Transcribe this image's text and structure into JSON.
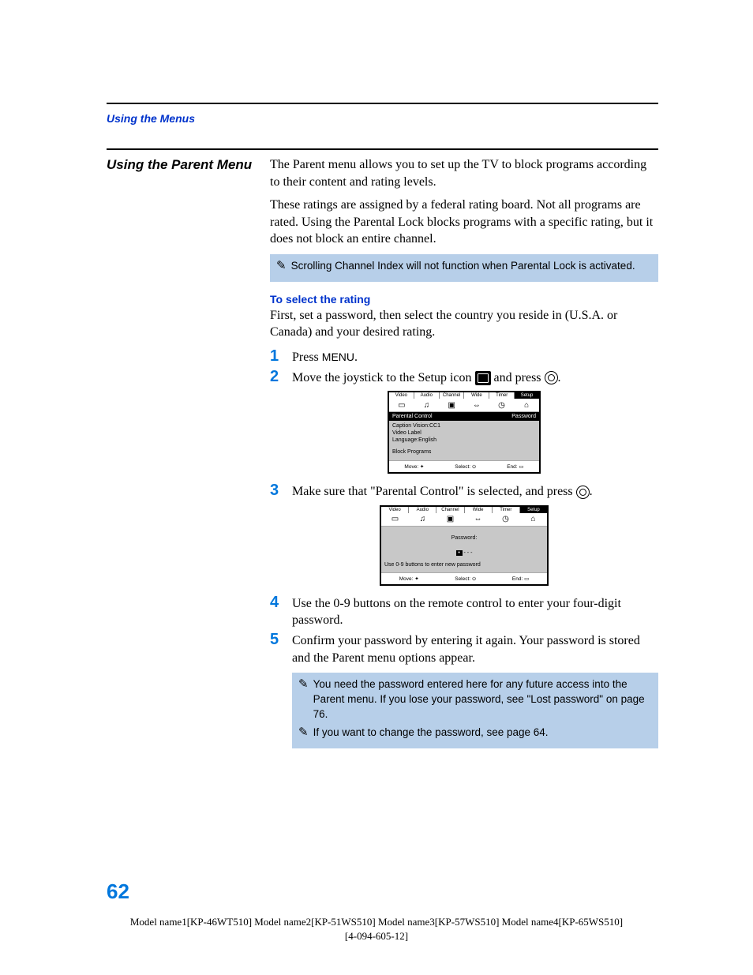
{
  "header": {
    "running": "Using the Menus"
  },
  "sideHeading": "Using the Parent Menu",
  "para1": "The Parent menu allows you to set up the TV to block programs according to their content and rating levels.",
  "para2": "These ratings are assigned by a federal rating board. Not all programs are rated. Using the Parental Lock blocks programs with a specific rating, but it does not block an entire channel.",
  "note1": "Scrolling Channel Index will not function when Parental Lock is activated.",
  "subHeading": "To select the rating",
  "para3": "First, set a password, then select the country you reside in (U.S.A. or Canada) and your desired rating.",
  "steps": {
    "s1_a": "Press ",
    "s1_b": "MENU",
    "s1_c": ".",
    "s2_a": "Move the joystick to the Setup icon ",
    "s2_b": " and press ",
    "s2_c": ".",
    "s3_a": "Make sure that \"Parental Control\" is selected, and press ",
    "s3_b": ".",
    "s4": "Use the 0-9 buttons on the remote control to enter your four-digit password.",
    "s5": "Confirm your password by entering it again. Your password is stored and the Parent menu options appear."
  },
  "note2a": "You need the password entered here for any future access into the Parent menu. If you lose your password, see \"Lost password\" on page 76.",
  "note2b": "If you want to change the password, see page 64.",
  "osd1": {
    "tabs": [
      "Video",
      "Audio",
      "Channel",
      "Wide",
      "Timer",
      "Setup"
    ],
    "rows": [
      {
        "l": "Parental Control",
        "r": "Password",
        "hl": true
      },
      {
        "l": "Caption Vision:CC1",
        "r": ""
      },
      {
        "l": "Video Label",
        "r": ""
      },
      {
        "l": "Language:English",
        "r": ""
      },
      {
        "l": "Block Programs",
        "r": ""
      }
    ],
    "footer": [
      "Move:",
      "Select:",
      "End:"
    ]
  },
  "osd2": {
    "tabs": [
      "Video",
      "Audio",
      "Channel",
      "Wide",
      "Timer",
      "Setup"
    ],
    "pwLabel": "Password:",
    "hint": "Use 0-9 buttons to enter new password",
    "footer": [
      "Move:",
      "Select:",
      "End:"
    ]
  },
  "pageNumber": "62",
  "footerModels": "Model name1[KP-46WT510] Model name2[KP-51WS510] Model name3[KP-57WS510] Model name4[KP-65WS510]",
  "footerDoc": "[4-094-605-12]"
}
